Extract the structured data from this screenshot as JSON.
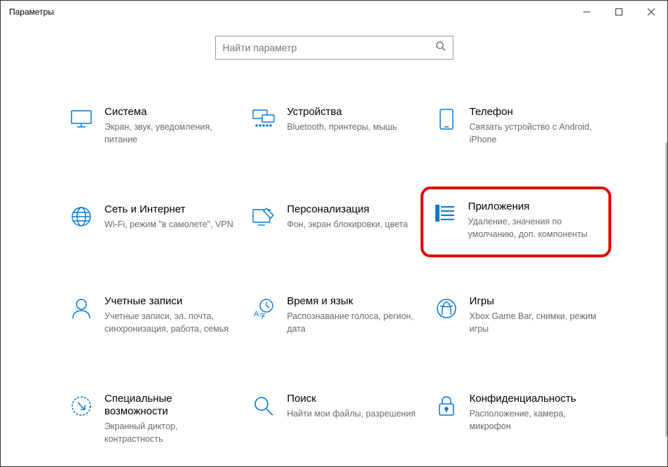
{
  "window": {
    "title": "Параметры"
  },
  "search": {
    "placeholder": "Найти параметр"
  },
  "tiles": {
    "system": {
      "title": "Система",
      "sub": "Экран, звук, уведомления, питание"
    },
    "devices": {
      "title": "Устройства",
      "sub": "Bluetooth, принтеры, мышь"
    },
    "phone": {
      "title": "Телефон",
      "sub": "Связать устройство с Android, iPhone"
    },
    "network": {
      "title": "Сеть и Интернет",
      "sub": "Wi-Fi, режим \"в самолете\", VPN"
    },
    "personal": {
      "title": "Персонализация",
      "sub": "Фон, экран блокировки, цвета"
    },
    "apps": {
      "title": "Приложения",
      "sub": "Удаление, значения по умолчанию, доп. компоненты"
    },
    "accounts": {
      "title": "Учетные записи",
      "sub": "Учетные записи, эл. почта, синхронизация, работа, семья"
    },
    "time": {
      "title": "Время и язык",
      "sub": "Распознавание голоса, регион, дата"
    },
    "gaming": {
      "title": "Игры",
      "sub": "Xbox Game Bar, снимки, режим игры"
    },
    "ease": {
      "title": "Специальные возможности",
      "sub": "Экранный диктор, контрастность"
    },
    "search_tile": {
      "title": "Поиск",
      "sub": "Найти мои файлы, разрешения"
    },
    "privacy": {
      "title": "Конфиденциальность",
      "sub": "Расположение, камера, микрофон"
    }
  }
}
